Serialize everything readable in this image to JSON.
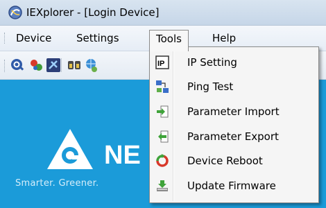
{
  "window": {
    "title": "IEXplorer - [Login Device]"
  },
  "menubar": {
    "items": [
      "Device",
      "Settings",
      "Tools",
      "Help"
    ]
  },
  "toolbar": {
    "buttons": [
      "search-device-icon",
      "connect-icon",
      "device-config-icon",
      "tools-icon",
      "network-icon"
    ]
  },
  "branding": {
    "wordmark": "NE",
    "tagline": "Smarter. Greener."
  },
  "tools_menu": {
    "items": [
      {
        "label": "IP Setting",
        "icon": "ip-icon"
      },
      {
        "label": "Ping Test",
        "icon": "ping-icon"
      },
      {
        "label": "Parameter Import",
        "icon": "import-icon"
      },
      {
        "label": "Parameter Export",
        "icon": "export-icon"
      },
      {
        "label": "Device Reboot",
        "icon": "reboot-icon"
      },
      {
        "label": "Update Firmware",
        "icon": "firmware-icon"
      }
    ]
  },
  "colors": {
    "content_bg": "#1b9bd9",
    "menu_bg": "#f5f5f5"
  }
}
